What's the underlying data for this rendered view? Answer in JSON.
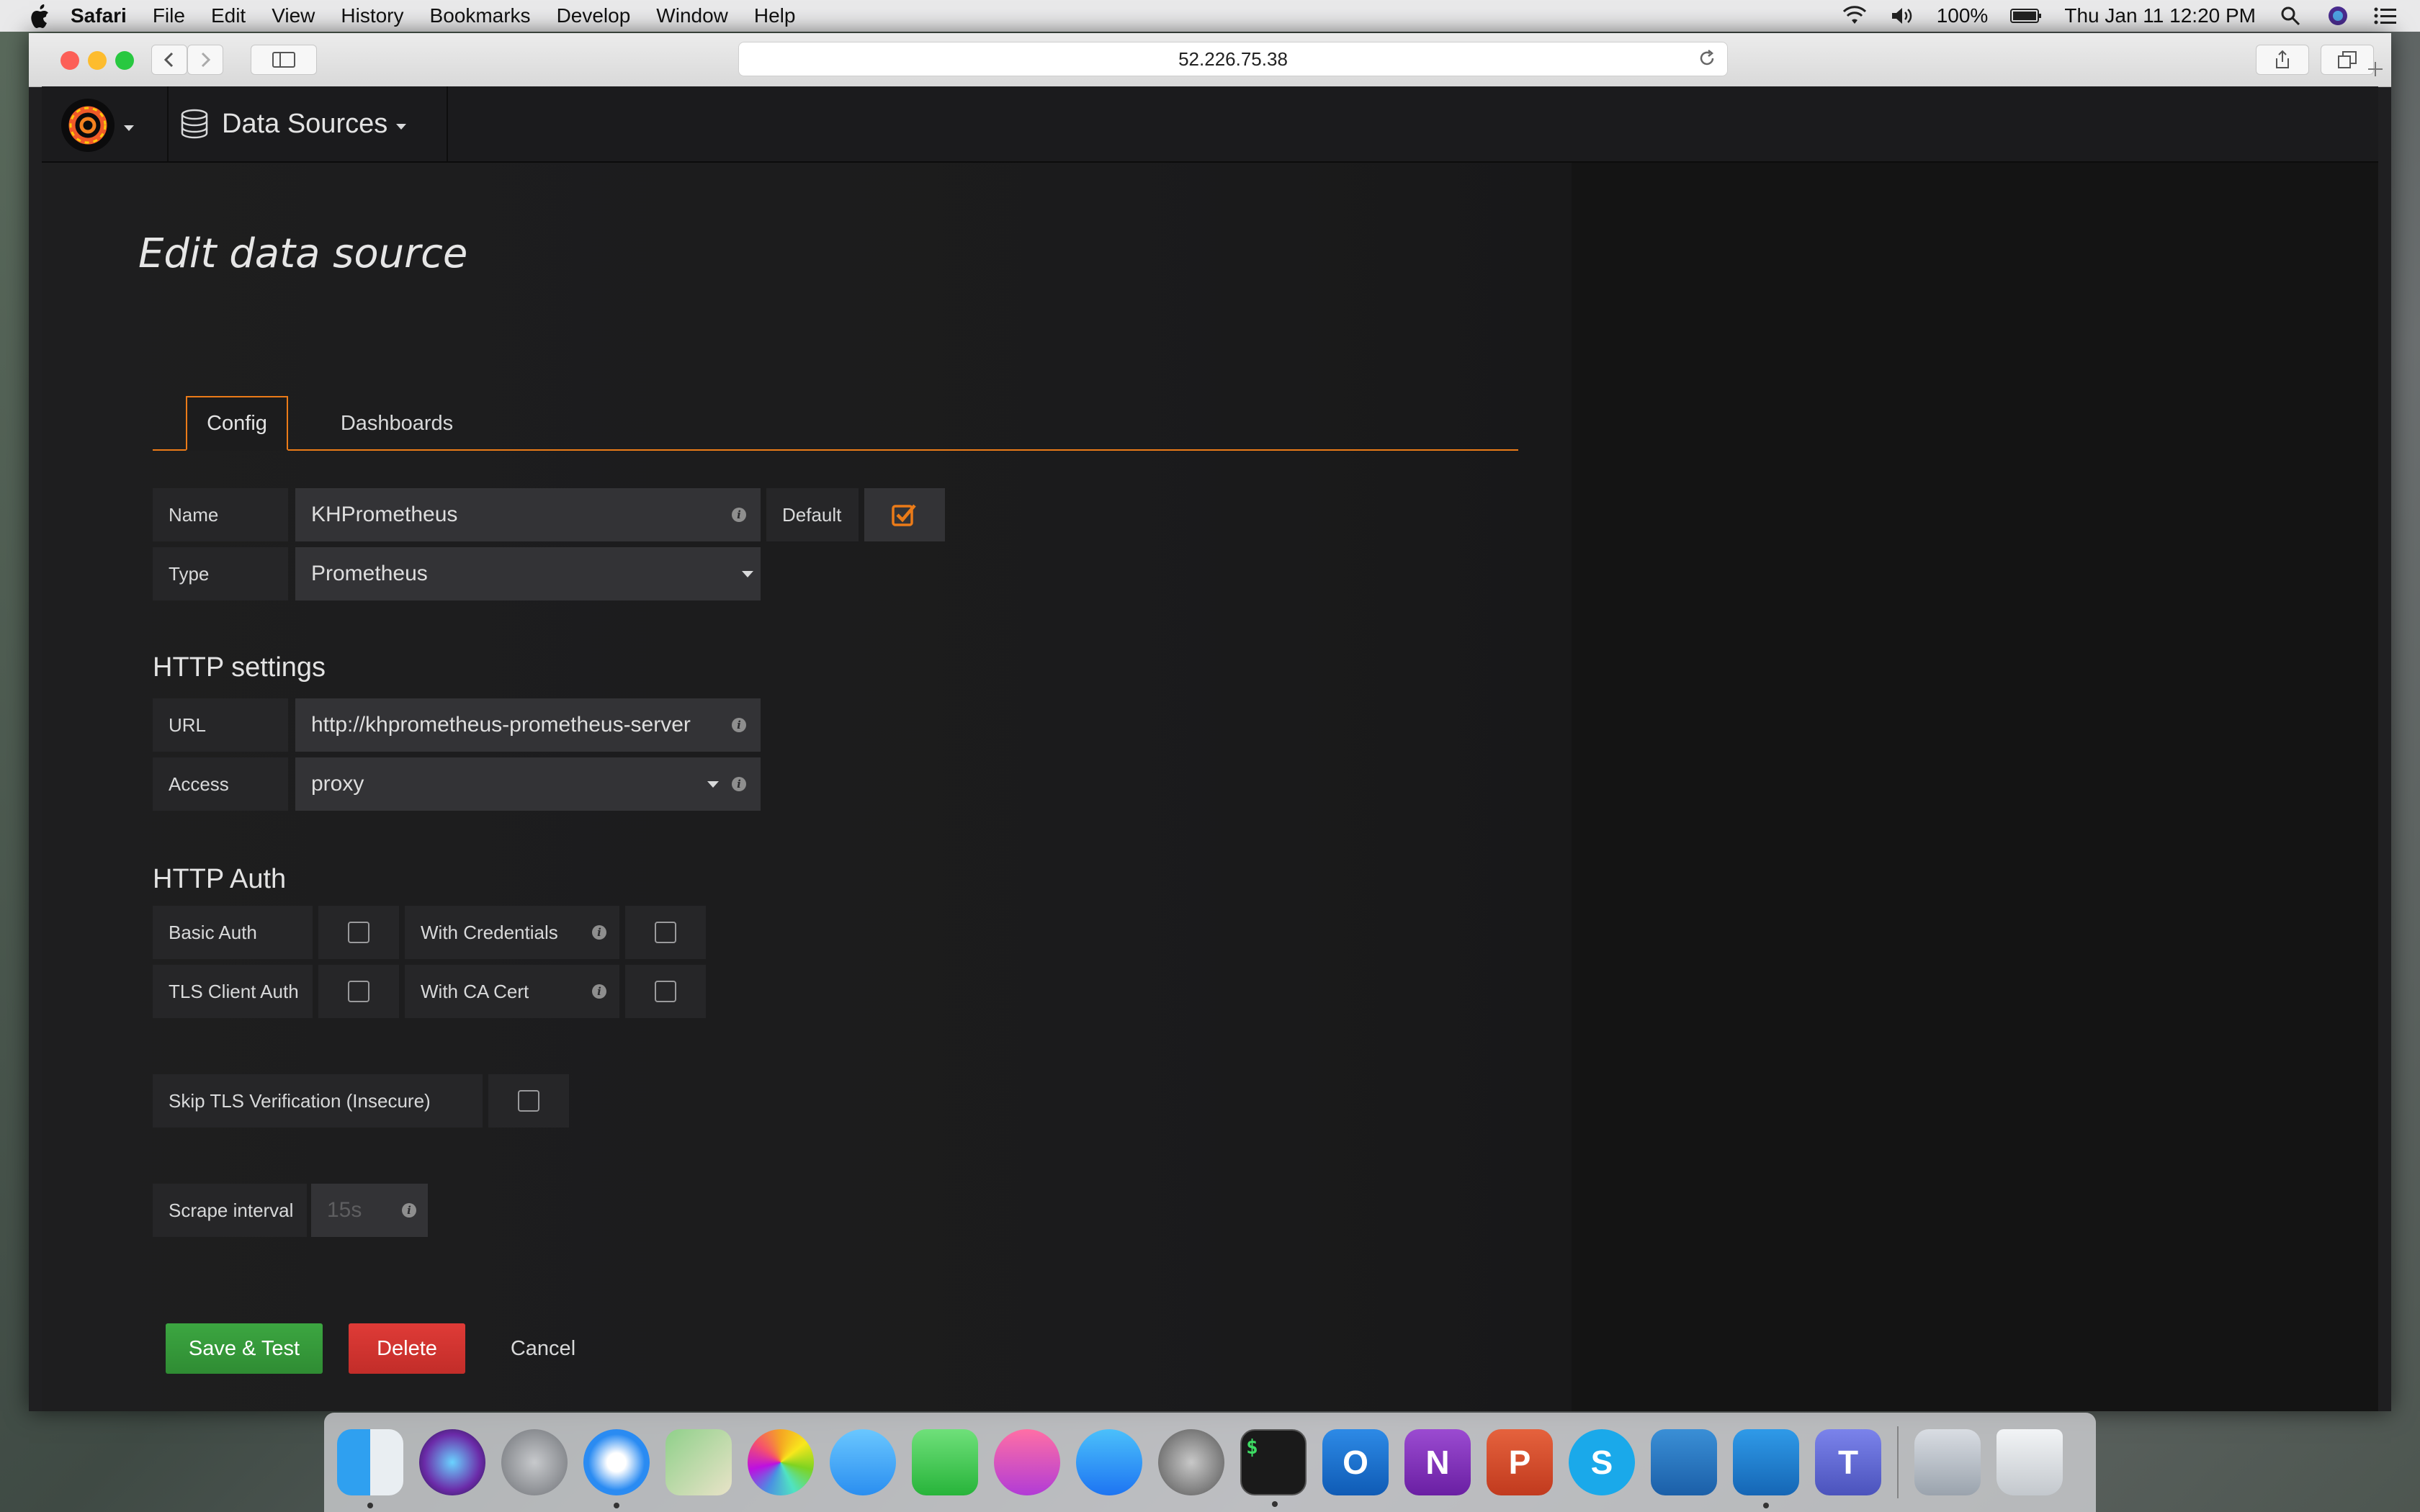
{
  "menubar": {
    "app": "Safari",
    "items": [
      "File",
      "Edit",
      "View",
      "History",
      "Bookmarks",
      "Develop",
      "Window",
      "Help"
    ],
    "battery": "100%",
    "datetime": "Thu Jan 11  12:20 PM"
  },
  "browser": {
    "url": "52.226.75.38"
  },
  "grafana": {
    "nav": {
      "section": "Data Sources"
    },
    "page_title": "Edit data source",
    "tabs": [
      {
        "label": "Config",
        "active": true
      },
      {
        "label": "Dashboards",
        "active": false
      }
    ],
    "fields": {
      "name_label": "Name",
      "name_value": "KHPrometheus",
      "default_label": "Default",
      "default_checked": true,
      "type_label": "Type",
      "type_value": "Prometheus"
    },
    "http_settings": {
      "heading": "HTTP settings",
      "url_label": "URL",
      "url_value": "http://khprometheus-prometheus-server",
      "access_label": "Access",
      "access_value": "proxy"
    },
    "http_auth": {
      "heading": "HTTP Auth",
      "basic_auth": "Basic Auth",
      "with_credentials": "With Credentials",
      "tls_client_auth": "TLS Client Auth",
      "with_ca_cert": "With CA Cert"
    },
    "skip_tls": "Skip TLS Verification (Insecure)",
    "scrape": {
      "label": "Scrape interval",
      "placeholder": "15s"
    },
    "buttons": {
      "save": "Save & Test",
      "delete": "Delete",
      "cancel": "Cancel"
    }
  },
  "dock": {
    "apps": [
      "finder",
      "siri",
      "launchpad",
      "safari",
      "maps",
      "photos",
      "messages",
      "facetime",
      "itunes",
      "app-store",
      "system-preferences",
      "terminal",
      "outlook",
      "onenote",
      "powerpoint",
      "skype",
      "azure",
      "vscode",
      "teams",
      "files",
      "trash"
    ],
    "terminal_glyph": "$",
    "outlook_glyph": "O",
    "onenote_glyph": "N",
    "powerpoint_glyph": "P",
    "skype_glyph": "S",
    "teams_glyph": "T"
  },
  "colors": {
    "accent": "#eb7b18",
    "save": "#3ca641",
    "delete": "#df3b37"
  }
}
